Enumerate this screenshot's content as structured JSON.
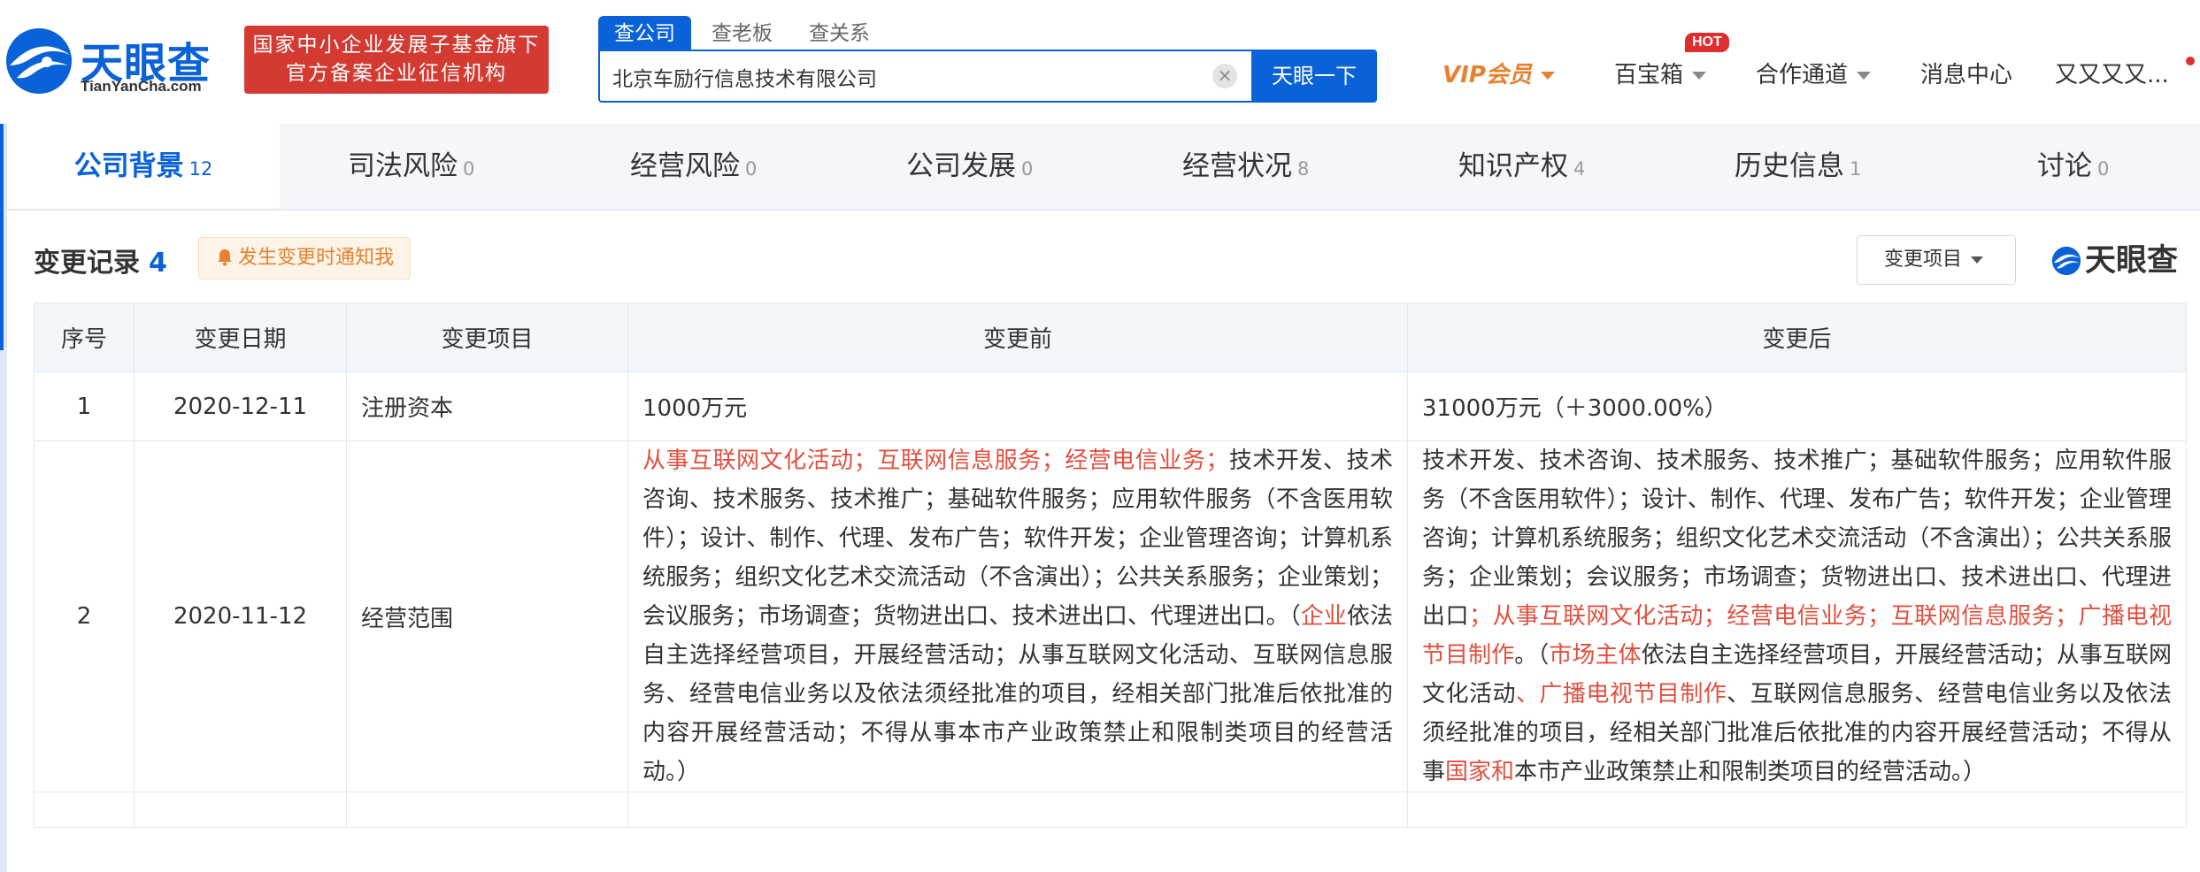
{
  "header": {
    "logo_text": "天眼查",
    "logo_sub": "TianYanCha.com",
    "gov_line1": "国家中小企业发展子基金旗下",
    "gov_line2": "官方备案企业征信机构",
    "search_tabs": [
      "查公司",
      "查老板",
      "查关系"
    ],
    "search_value": "北京车励行信息技术有限公司",
    "search_button": "天眼一下",
    "nav": {
      "vip": "VIP会员",
      "treasure": "百宝箱",
      "hot": "HOT",
      "cooperation": "合作通道",
      "messages": "消息中心",
      "user": "又又又又..."
    }
  },
  "tabs": [
    {
      "label": "公司背景",
      "count": "12"
    },
    {
      "label": "司法风险",
      "count": "0"
    },
    {
      "label": "经营风险",
      "count": "0"
    },
    {
      "label": "公司发展",
      "count": "0"
    },
    {
      "label": "经营状况",
      "count": "8"
    },
    {
      "label": "知识产权",
      "count": "4"
    },
    {
      "label": "历史信息",
      "count": "1"
    },
    {
      "label": "讨论",
      "count": "0"
    }
  ],
  "section": {
    "title": "变更记录",
    "count": "4",
    "notify": "发生变更时通知我",
    "filter": "变更项目",
    "logo": "天眼查"
  },
  "table": {
    "headers": [
      "序号",
      "变更日期",
      "变更项目",
      "变更前",
      "变更后"
    ],
    "row1": {
      "index": "1",
      "date": "2020-12-11",
      "item": "注册资本",
      "before": "1000万元",
      "after": "31000万元（＋3000.00%）"
    },
    "row2": {
      "index": "2",
      "date": "2020-11-12",
      "item": "经营范围",
      "before": {
        "p1_red": "从事互联网文化活动；互联网信息服务；经营电信业务；",
        "p2": "技术开发、技术咨询、技术服务、技术推广；基础软件服务；应用软件服务（不含医用软件）；设计、制作、代理、发布广告；软件开发；企业管理咨询；计算机系统服务；组织文化艺术交流活动（不含演出）；公共关系服务；企业策划；会议服务；市场调查；货物进出口、技术进出口、代理进出口。（",
        "p3_red": "企业",
        "p4": "依法自主选择经营项目，开展经营活动；从事互联网文化活动、互联网信息服务、经营电信业务以及依法须经批准的项目，经相关部门批准后依批准的内容开展经营活动；不得从事本市产业政策禁止和限制类项目的经营活动。）"
      },
      "after": {
        "p1": "技术开发、技术咨询、技术服务、技术推广；基础软件服务；应用软件服务（不含医用软件）；设计、制作、代理、发布广告；软件开发；企业管理咨询；计算机系统服务；组织文化艺术交流活动（不含演出）；公共关系服务；企业策划；会议服务；市场调查；货物进出口、技术进出口、代理进出口",
        "p2_red": "；从事互联网文化活动；经营电信业务；互联网信息服务；广播电视节目制作",
        "p3": "。（",
        "p4_red": "市场主体",
        "p5": "依法自主选择经营项目，开展经营活动；从事互联网文化活动",
        "p6_red": "、广播电视节目制作",
        "p7": "、互联网信息服务、经营电信业务以及依法须经批准的项目，经相关部门批准后依批准的内容开展经营活动；不得从事",
        "p8_red": "国家和",
        "p9": "本市产业政策禁止和限制类项目的经营活动。）"
      }
    }
  },
  "colors": {
    "brand_blue": "#0a62d8",
    "gov_red": "#d33a32",
    "vip_orange": "#e5812f",
    "change_red": "#e0503f"
  }
}
